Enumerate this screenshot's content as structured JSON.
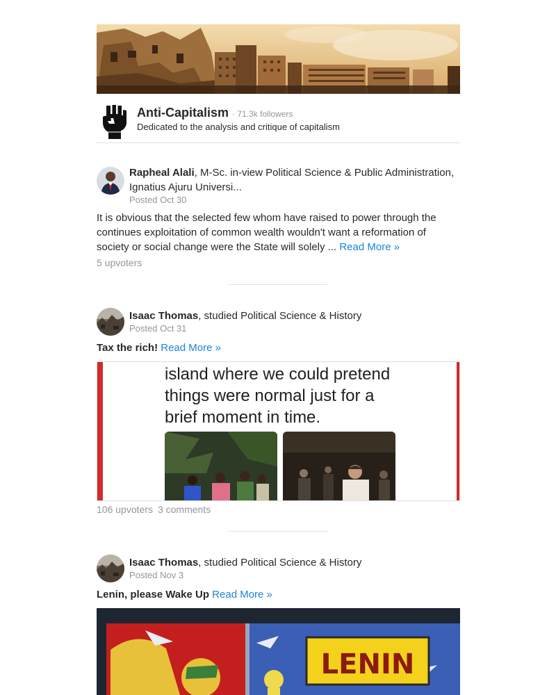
{
  "space": {
    "title": "Anti-Capitalism",
    "followers": "· 71.3k followers",
    "description": "Dedicated to the analysis and critique of capitalism",
    "icon": "raised-fist-icon"
  },
  "posts": [
    {
      "author_name": "Rapheal Alali",
      "author_credential": ", M-Sc. in-view Political Science & Public Administration, Ignatius Ajuru Universi...",
      "posted": "Posted Oct 30",
      "text": "It is obvious that the selected few whom have raised to power through the continues exploitation of common wealth wouldn't want a reformation of society or social change were the State will solely ...",
      "read_more": "Read More »",
      "upvoters": "5 upvoters"
    },
    {
      "author_name": "Isaac Thomas",
      "author_credential": ", studied Political Science & History",
      "posted": "Posted Oct 31",
      "title": "Tax the rich!",
      "read_more": "Read More »",
      "image_text": [
        "island where we could pretend",
        "things were normal just for a",
        "brief moment in time."
      ],
      "upvoters": "106 upvoters",
      "comments": "3 comments"
    },
    {
      "author_name": "Isaac Thomas",
      "author_credential": ", studied Political Science & History",
      "posted": "Posted Nov 3",
      "title": "Lenin, please Wake Up",
      "read_more": "Read More »",
      "image_text": "LENIN"
    }
  ],
  "colors": {
    "link": "#1a84d8",
    "muted": "#939598",
    "text": "#282829",
    "accent_red": "#d42a2a"
  }
}
